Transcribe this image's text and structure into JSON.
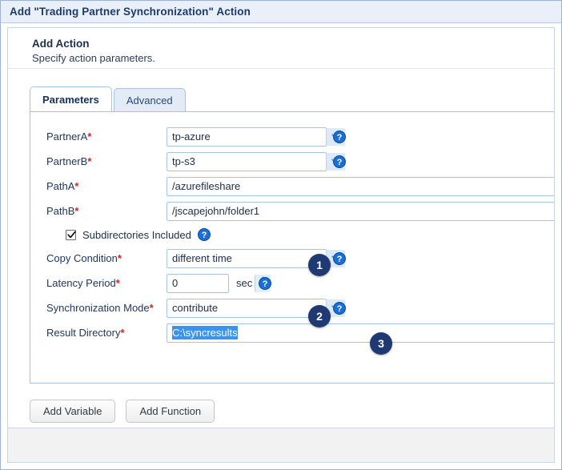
{
  "window": {
    "title": "Add \"Trading Partner Synchronization\" Action"
  },
  "header": {
    "title": "Add Action",
    "subtitle": "Specify action parameters."
  },
  "tabs": [
    {
      "label": "Parameters",
      "active": true
    },
    {
      "label": "Advanced",
      "active": false
    }
  ],
  "form": {
    "partner_a": {
      "label": "PartnerA",
      "required": "*",
      "value": "tp-azure",
      "type": "select",
      "help": "help-icon"
    },
    "partner_b": {
      "label": "PartnerB",
      "required": "*",
      "value": "tp-s3",
      "type": "select",
      "help": "help-icon"
    },
    "path_a": {
      "label": "PathA",
      "required": "*",
      "value": "/azurefileshare",
      "type": "text"
    },
    "path_b": {
      "label": "PathB",
      "required": "*",
      "value": "/jscapejohn/folder1",
      "type": "text"
    },
    "subdirectories": {
      "label": "Subdirectories Included",
      "checked": true,
      "checkmark": "check-icon"
    },
    "copy_condition": {
      "label": "Copy Condition",
      "required": "*",
      "value": "different time",
      "type": "select"
    },
    "latency_period": {
      "label": "Latency Period",
      "required": "*",
      "value": "0",
      "suffix": "sec",
      "type": "spinner"
    },
    "synchronization_mode": {
      "label": "Synchronization Mode",
      "required": "*",
      "value": "contribute",
      "type": "select"
    },
    "result_directory": {
      "label": "Result Directory",
      "required": "*",
      "value": "C:\\syncresults",
      "type": "text",
      "selected": true
    }
  },
  "buttons": {
    "add_variable": "Add Variable",
    "add_function": "Add Function"
  },
  "callouts": [
    {
      "number": "1",
      "target": "copy-condition-field"
    },
    {
      "number": "2",
      "target": "synchronization-mode-field"
    },
    {
      "number": "3",
      "target": "result-directory-field"
    }
  ],
  "colors": {
    "titlebar_bg": "#eaf0f9",
    "title_text": "#1e3a6b",
    "required_asterisk": "#d41f1f",
    "field_border": "#a8c4e2",
    "badge_bg": "#1f3a73",
    "selection_bg": "#3b93f0",
    "help_icon_bg": "#1a6fd4"
  }
}
